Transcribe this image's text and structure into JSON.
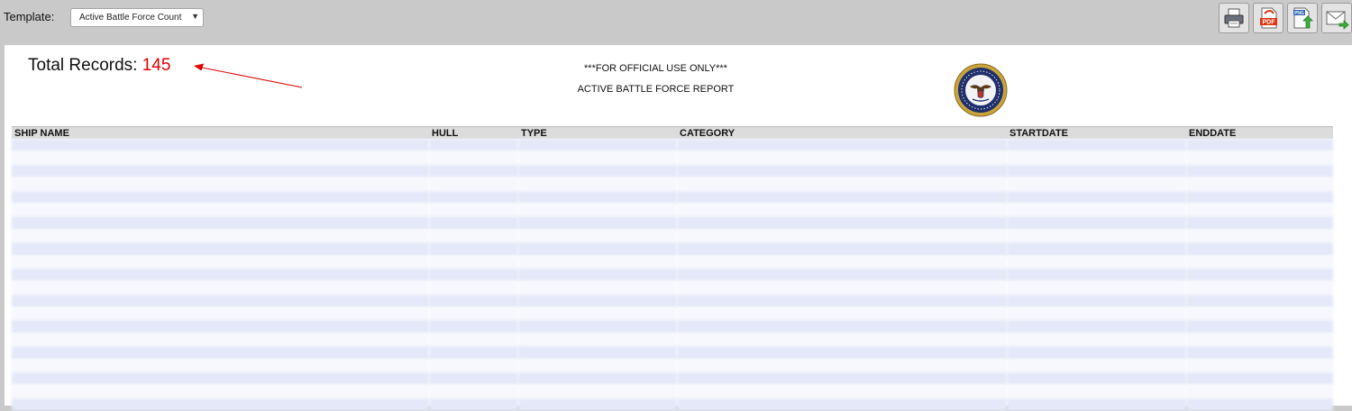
{
  "toolbar": {
    "template_label": "Template:",
    "template_value": "Active Battle Force Count",
    "buttons": [
      {
        "name": "print-button",
        "icon": "printer-icon"
      },
      {
        "name": "export-pdf-button",
        "icon": "pdf-icon",
        "text": "PDF"
      },
      {
        "name": "export-png-button",
        "icon": "png-upload-icon",
        "text": "PNG"
      },
      {
        "name": "email-button",
        "icon": "envelope-icon"
      }
    ]
  },
  "report": {
    "total_label": "Total Records:",
    "total_count": "145",
    "classification": "***FOR OFFICIAL USE ONLY***",
    "title": "ACTIVE BATTLE FORCE REPORT",
    "seal_icon": "navy-seal-icon"
  },
  "table": {
    "columns": [
      "SHIP NAME",
      "HULL",
      "TYPE",
      "CATEGORY",
      "STARTDATE",
      "ENDDATE"
    ],
    "rows": [
      [
        "",
        "",
        "",
        "",
        "",
        ""
      ],
      [
        "",
        "",
        "",
        "",
        "",
        ""
      ],
      [
        "",
        "",
        "",
        "",
        "",
        ""
      ],
      [
        "",
        "",
        "",
        "",
        "",
        ""
      ],
      [
        "",
        "",
        "",
        "",
        "",
        ""
      ],
      [
        "",
        "",
        "",
        "",
        "",
        ""
      ],
      [
        "",
        "",
        "",
        "",
        "",
        ""
      ],
      [
        "",
        "",
        "",
        "",
        "",
        ""
      ],
      [
        "",
        "",
        "",
        "",
        "",
        ""
      ],
      [
        "",
        "",
        "",
        "",
        "",
        ""
      ],
      [
        "",
        "",
        "",
        "",
        "",
        ""
      ],
      [
        "",
        "",
        "",
        "",
        "",
        ""
      ],
      [
        "",
        "",
        "",
        "",
        "",
        ""
      ],
      [
        "",
        "",
        "",
        "",
        "",
        ""
      ],
      [
        "",
        "",
        "",
        "",
        "",
        ""
      ],
      [
        "",
        "",
        "",
        "",
        "",
        ""
      ],
      [
        "",
        "",
        "",
        "",
        "",
        ""
      ],
      [
        "",
        "",
        "",
        "",
        "",
        ""
      ],
      [
        "",
        "",
        "",
        "",
        "",
        ""
      ],
      [
        "",
        "",
        "",
        "",
        "",
        ""
      ],
      [
        "",
        "",
        "",
        "",
        "",
        ""
      ]
    ]
  },
  "colors": {
    "accent_red": "#e00000",
    "row_band_dark": "#e4e8f8",
    "row_band_light": "#f7f8fd",
    "toolbar_bg": "#c9c9c9"
  }
}
